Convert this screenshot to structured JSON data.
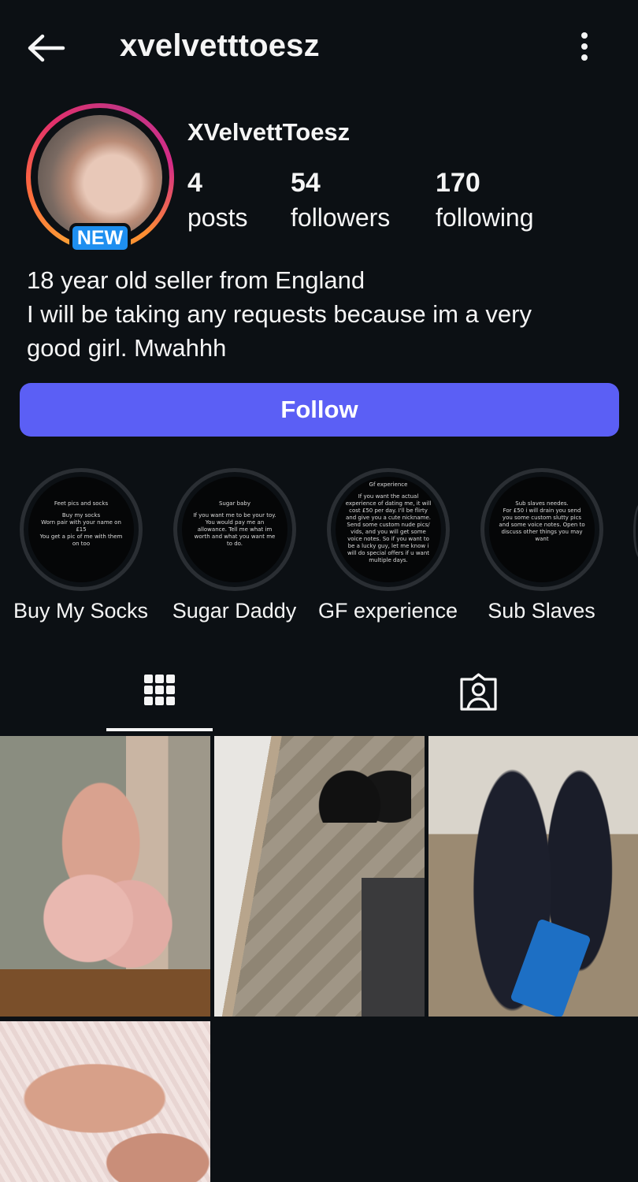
{
  "header": {
    "username": "xvelvetttoesz"
  },
  "profile": {
    "display_name": "XVelvettToesz",
    "new_badge": "NEW",
    "stats": [
      {
        "count": "4",
        "label": "posts"
      },
      {
        "count": "54",
        "label": "followers"
      },
      {
        "count": "170",
        "label": "following"
      }
    ],
    "bio": [
      "18 year old seller from England",
      "I will be taking any requests because im a very",
      "good girl. Mwahhh"
    ],
    "follow_label": "Follow",
    "follow_color": "#5b5ff5"
  },
  "highlights": [
    {
      "label": "Buy My Socks",
      "cover_title": "Feet pics and socks",
      "cover_text": "Buy my socks\nWorn pair with your name on £15\nYou get a pic of me with them on too"
    },
    {
      "label": "Sugar Daddy",
      "cover_title": "Sugar baby",
      "cover_text": "If you want me to be your toy. You would pay me an allowance. Tell me what im worth and what you want me to do."
    },
    {
      "label": "GF experience",
      "cover_title": "Gf experience",
      "cover_text": "If you want the actual experience of dating me, it will cost £50 per day. I'll be flirty and give you a cute nickname. Send some custom nude pics/ vids, and you will get some voice notes. So if you want to be a lucky guy, let me know i will do special offers if u want multiple days."
    },
    {
      "label": "Sub Slaves",
      "cover_title": "Sub slaves needes.",
      "cover_text": "For £50 i will drain you send you some custom slutty pics and some voice notes. Open to discuss other things you may want"
    }
  ],
  "tabs": [
    {
      "icon": "grid-icon",
      "active": true
    },
    {
      "icon": "tagged-icon",
      "active": false
    }
  ],
  "grid": [
    {
      "icon": "photo"
    },
    {
      "icon": "photo"
    },
    {
      "icon": "photo"
    },
    {
      "icon": "photo"
    }
  ],
  "colors": {
    "background": "#0c1014",
    "new_badge": "#1e8ff0",
    "highlight_ring": "#2a2e33"
  }
}
